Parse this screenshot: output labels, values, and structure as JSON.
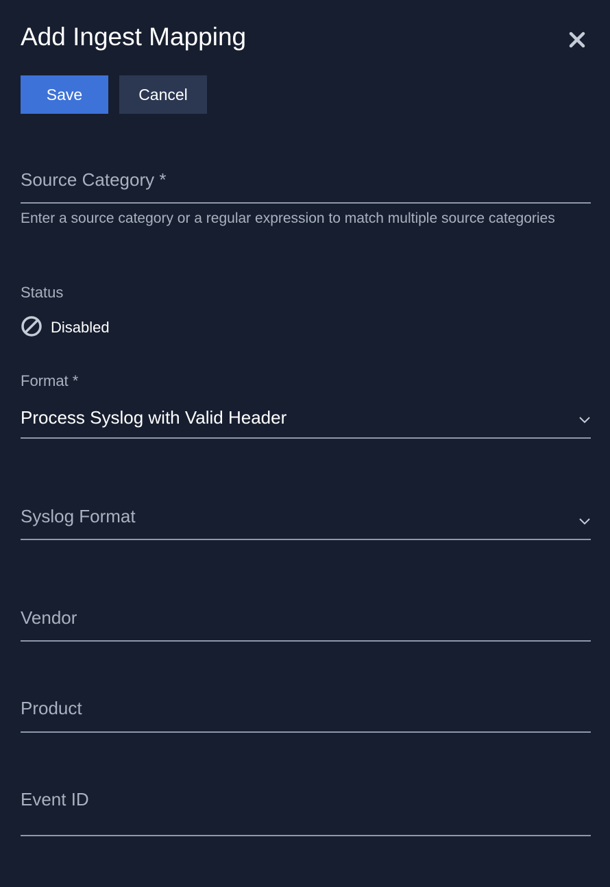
{
  "dialog": {
    "title": "Add Ingest Mapping",
    "close_icon": "close-icon"
  },
  "toolbar": {
    "save_label": "Save",
    "cancel_label": "Cancel",
    "save_color": "#3d72d8",
    "cancel_color": "#2c3852"
  },
  "form": {
    "source_category": {
      "placeholder": "Source Category *",
      "helper": "Enter a source category or a regular expression to match multiple source categories"
    },
    "status": {
      "label": "Status",
      "value": "Disabled",
      "icon": "disabled-icon"
    },
    "format": {
      "label": "Format *",
      "value": "Process Syslog with Valid Header",
      "icon": "chevron-down-icon"
    },
    "syslog_format": {
      "placeholder": "Syslog Format",
      "icon": "chevron-down-icon"
    },
    "vendor": {
      "placeholder": "Vendor"
    },
    "product": {
      "placeholder": "Product"
    },
    "event_id": {
      "placeholder": "Event ID"
    }
  },
  "colors": {
    "background": "#171e2f",
    "muted_text": "#a9b2c0",
    "underline": "#8e99ab"
  }
}
